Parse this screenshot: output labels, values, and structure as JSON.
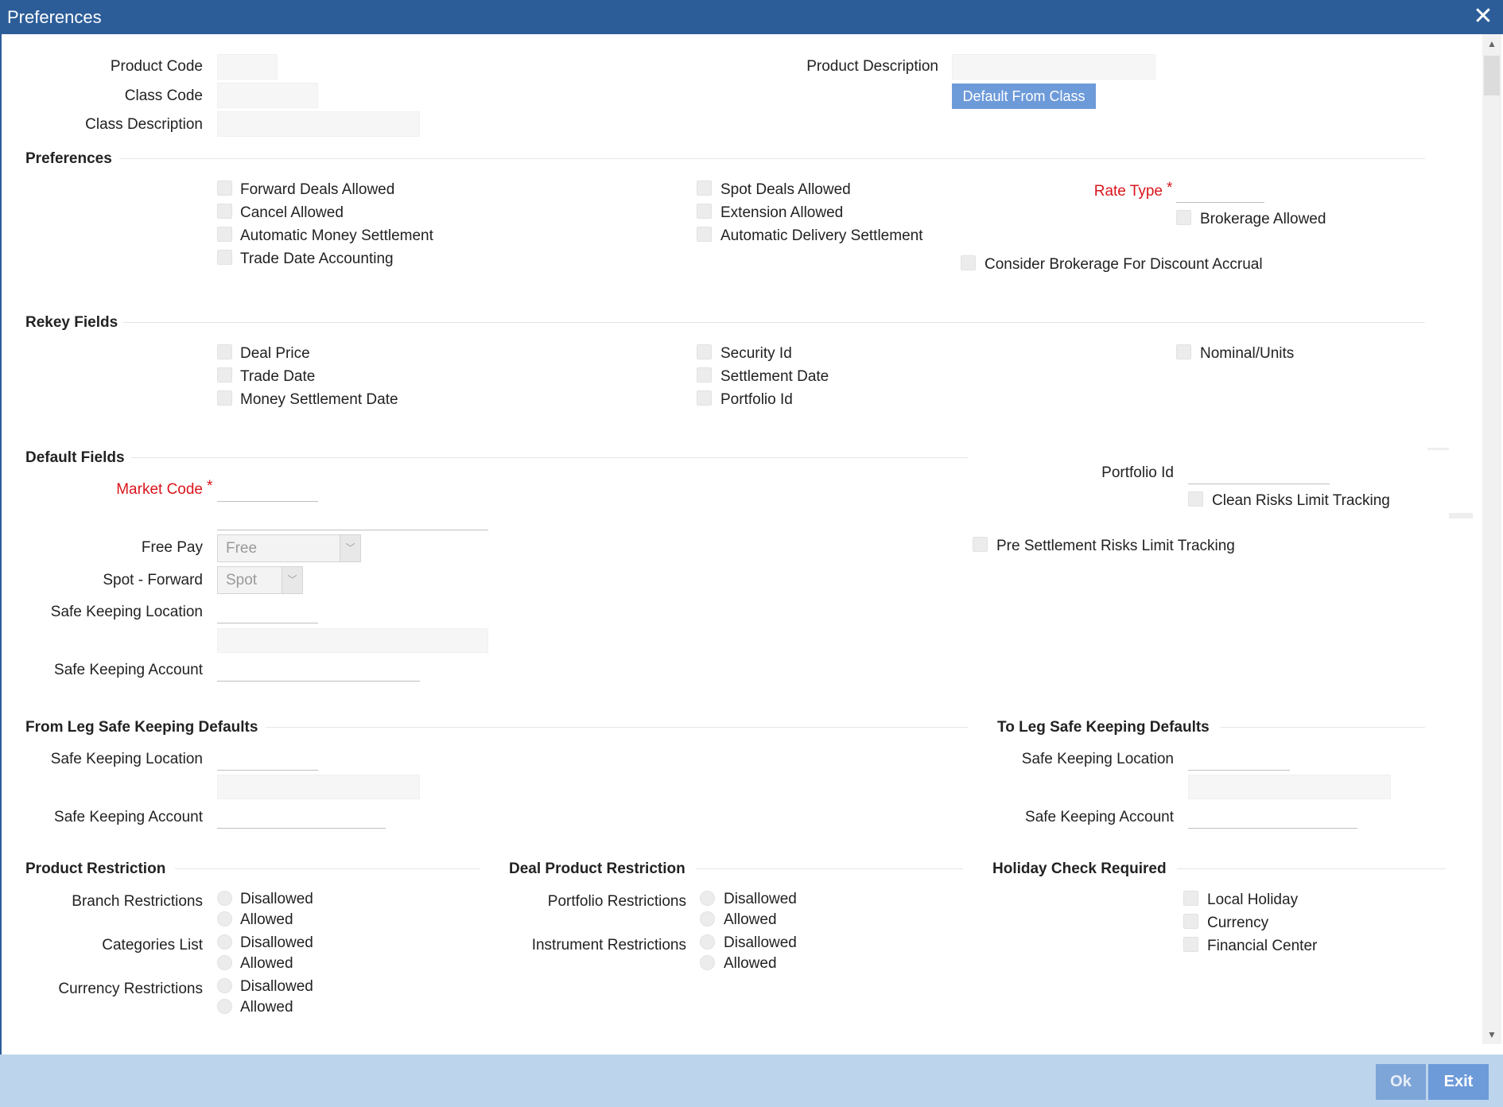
{
  "window": {
    "title": "Preferences"
  },
  "header": {
    "product_code_label": "Product Code",
    "class_code_label": "Class Code",
    "class_description_label": "Class Description",
    "product_description_label": "Product Description",
    "default_from_class_button": "Default From Class"
  },
  "preferences": {
    "section_title": "Preferences",
    "forward_deals_allowed": "Forward Deals Allowed",
    "cancel_allowed": "Cancel Allowed",
    "automatic_money_settlement": "Automatic Money Settlement",
    "trade_date_accounting": "Trade Date Accounting",
    "spot_deals_allowed": "Spot Deals Allowed",
    "extension_allowed": "Extension Allowed",
    "automatic_delivery_settlement": "Automatic Delivery Settlement",
    "rate_type_label": "Rate Type",
    "required_marker": "*",
    "brokerage_allowed": "Brokerage Allowed",
    "consider_brokerage": "Consider Brokerage For Discount Accrual"
  },
  "rekey": {
    "section_title": "Rekey Fields",
    "deal_price": "Deal Price",
    "trade_date": "Trade Date",
    "money_settlement_date": "Money Settlement Date",
    "security_id": "Security Id",
    "settlement_date": "Settlement Date",
    "portfolio_id": "Portfolio Id",
    "nominal_units": "Nominal/Units"
  },
  "default_fields": {
    "section_title": "Default Fields",
    "market_code_label": "Market Code",
    "required_marker": "*",
    "free_pay_label": "Free Pay",
    "free_pay_value": "Free",
    "spot_forward_label": "Spot - Forward",
    "spot_forward_value": "Spot",
    "safe_keeping_location_label": "Safe Keeping Location",
    "safe_keeping_account_label": "Safe Keeping Account",
    "portfolio_id_label": "Portfolio Id",
    "clean_risks_limit_tracking": "Clean Risks Limit Tracking",
    "pre_settlement_risks_limit_tracking": "Pre Settlement Risks Limit Tracking"
  },
  "from_leg": {
    "section_title": "From Leg Safe Keeping Defaults",
    "safe_keeping_location_label": "Safe Keeping Location",
    "safe_keeping_account_label": "Safe Keeping Account"
  },
  "to_leg": {
    "section_title": "To Leg Safe Keeping Defaults",
    "safe_keeping_location_label": "Safe Keeping Location",
    "safe_keeping_account_label": "Safe Keeping Account"
  },
  "product_restriction": {
    "section_title": "Product Restriction",
    "branch_label": "Branch Restrictions",
    "categories_label": "Categories List",
    "currency_label": "Currency Restrictions",
    "disallowed": "Disallowed",
    "allowed": "Allowed"
  },
  "deal_product_restriction": {
    "section_title": "Deal Product Restriction",
    "portfolio_label": "Portfolio Restrictions",
    "instrument_label": "Instrument Restrictions",
    "disallowed": "Disallowed",
    "allowed": "Allowed"
  },
  "holiday_check": {
    "section_title": "Holiday Check Required",
    "local_holiday": "Local Holiday",
    "currency": "Currency",
    "financial_center": "Financial Center"
  },
  "footer": {
    "ok_label": "Ok",
    "exit_label": "Exit"
  }
}
